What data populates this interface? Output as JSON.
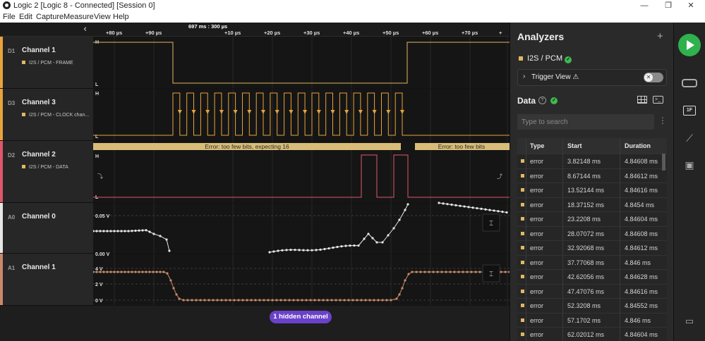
{
  "window": {
    "title": "Logic 2 [Logic 8 - Connected] [Session 0]",
    "controls": [
      "—",
      "❐",
      "✕"
    ]
  },
  "menu": [
    "File",
    "Edit",
    "Capture",
    "Measure",
    "View",
    "Help"
  ],
  "timeline": {
    "cursor_label": "697 ms : 300 µs",
    "ticks": [
      "+80 µs",
      "+90 µs",
      "+10 µs",
      "+20 µs",
      "+30 µs",
      "+40 µs",
      "+50 µs",
      "+60 µs",
      "+70 µs",
      "+"
    ]
  },
  "channels": [
    {
      "tag": "D1",
      "name": "Channel 1",
      "analyzer_label": "I2S / PCM - FRAME",
      "color": "#e0b860"
    },
    {
      "tag": "D3",
      "name": "Channel 3",
      "analyzer_label": "I2S / PCM - CLOCK chan...",
      "color": "#e8a33a"
    },
    {
      "tag": "D2",
      "name": "Channel 2",
      "analyzer_label": "I2S / PCM - DATA",
      "color": "#e0566b"
    },
    {
      "tag": "A0",
      "name": "Channel 0",
      "color": "#e6e6e6"
    },
    {
      "tag": "A1",
      "name": "Channel 1",
      "color": "#c98a6a"
    }
  ],
  "waveform": {
    "digital_labels": {
      "high": "H",
      "low": "L"
    },
    "decode_errors": [
      "Error: too few bits, expecting 16",
      "Error: too few bits"
    ],
    "analog0_ticks": [
      "0.05 V",
      "0.00 V"
    ],
    "analog1_ticks": [
      "4 V",
      "2 V",
      "0 V"
    ],
    "ui_colors": {
      "frame": "#e0b860",
      "clock": "#e8a33a",
      "data": "#e0566b",
      "analog0": "#e6e6e6",
      "analog1": "#c98a6a",
      "decode_bar": "#d8bd78"
    }
  },
  "hidden_channels": "1 hidden channel",
  "analyzers": {
    "title": "Analyzers",
    "add_icon": "plus-icon",
    "items": [
      {
        "name": "I2S / PCM",
        "status": "ok"
      }
    ],
    "trigger_view": "Trigger View ⚠"
  },
  "data_panel": {
    "title": "Data",
    "search_placeholder": "Type to search",
    "columns": [
      "Type",
      "Start",
      "Duration"
    ],
    "rows": [
      {
        "type": "error",
        "start": "3.82148 ms",
        "duration": "4.84608 ms"
      },
      {
        "type": "error",
        "start": "8.67144 ms",
        "duration": "4.84612 ms"
      },
      {
        "type": "error",
        "start": "13.52144 ms",
        "duration": "4.84616 ms"
      },
      {
        "type": "error",
        "start": "18.37152 ms",
        "duration": "4.8454 ms"
      },
      {
        "type": "error",
        "start": "23.2208 ms",
        "duration": "4.84604 ms"
      },
      {
        "type": "error",
        "start": "28.07072 ms",
        "duration": "4.84608 ms"
      },
      {
        "type": "error",
        "start": "32.92068 ms",
        "duration": "4.84612 ms"
      },
      {
        "type": "error",
        "start": "37.77068 ms",
        "duration": "4.846 ms"
      },
      {
        "type": "error",
        "start": "42.62056 ms",
        "duration": "4.84628 ms"
      },
      {
        "type": "error",
        "start": "47.47076 ms",
        "duration": "4.84616 ms"
      },
      {
        "type": "error",
        "start": "52.3208 ms",
        "duration": "4.84552 ms"
      },
      {
        "type": "error",
        "start": "57.1702 ms",
        "duration": "4.846 ms"
      },
      {
        "type": "error",
        "start": "62.02012 ms",
        "duration": "4.84604 ms"
      }
    ]
  },
  "rail": {
    "extension_label": "1F"
  }
}
